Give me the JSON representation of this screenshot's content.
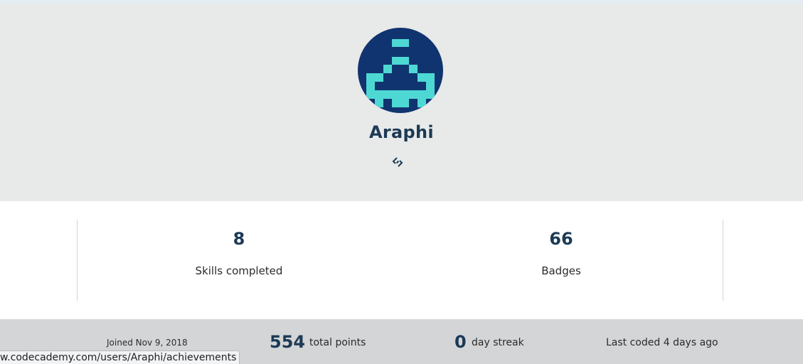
{
  "profile": {
    "username": "Araphi",
    "avatar_colors": {
      "background": "#10346f",
      "pixels": "#4ed8d4"
    }
  },
  "icons": {
    "link": "link-chain-icon"
  },
  "stats": {
    "skills": {
      "value": "8",
      "label": "Skills completed"
    },
    "badges": {
      "value": "66",
      "label": "Badges"
    }
  },
  "footer": {
    "joined": "Joined Nov 9, 2018",
    "points_value": "554",
    "points_label": "total points",
    "streak_value": "0",
    "streak_label": "day streak",
    "last_coded": "Last coded 4 days ago"
  },
  "status_bar": {
    "url": "w.codecademy.com/users/Araphi/achievements"
  },
  "colors": {
    "header_bg": "#e8e9e9",
    "accent_text": "#1c3a55",
    "footer_bg": "#d4d5d6"
  }
}
